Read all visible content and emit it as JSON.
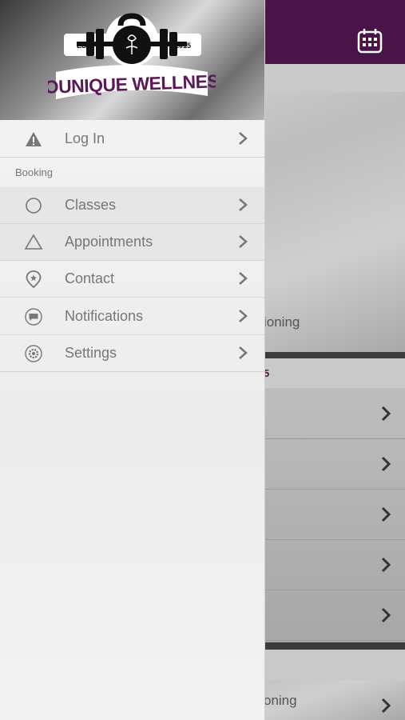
{
  "brand": {
    "name": "YOUNIQUE WELLNESS",
    "est": "EST",
    "year": "2015"
  },
  "menu": {
    "login": "Log In",
    "section": "Booking",
    "items": [
      {
        "label": "Classes",
        "icon": "circle-icon"
      },
      {
        "label": "Appointments",
        "icon": "triangle-icon"
      },
      {
        "label": "Contact",
        "icon": "location-pin-icon"
      },
      {
        "label": "Notifications",
        "icon": "chat-bubble-icon"
      },
      {
        "label": "Settings",
        "icon": "gear-icon"
      }
    ]
  },
  "background": {
    "partial_text_1": "ioning",
    "partial_text_2": "5",
    "partial_text_3": "oning"
  },
  "colors": {
    "header": "#4a1446",
    "brand_purple": "#5a1a57"
  }
}
